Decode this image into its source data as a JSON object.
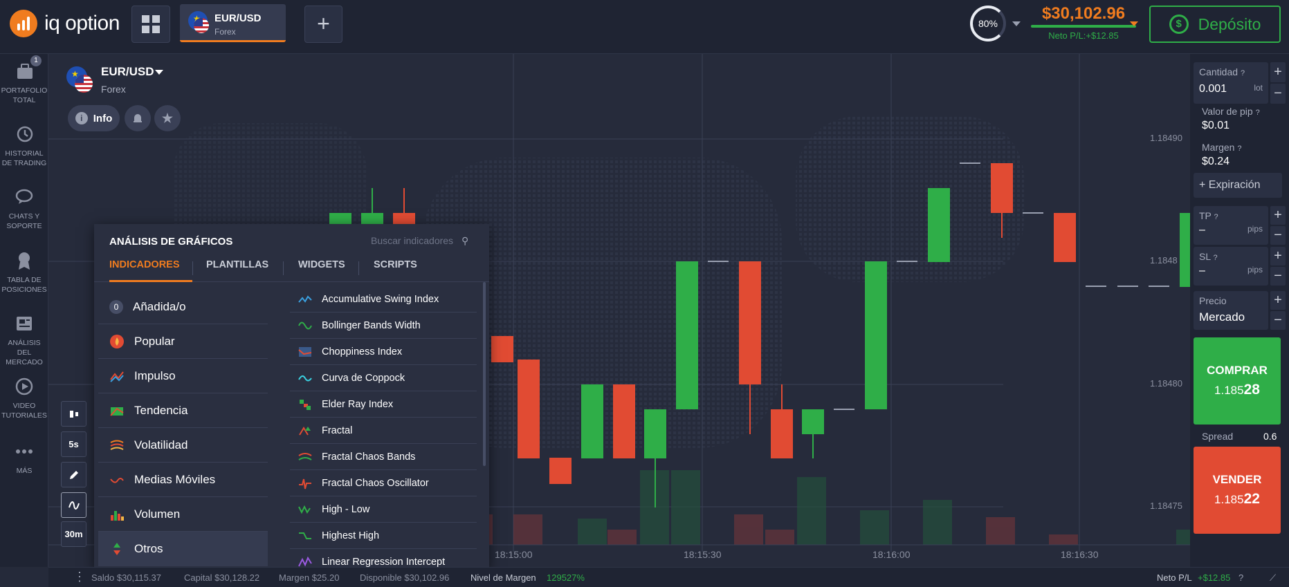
{
  "topbar": {
    "logo_text": "iq option",
    "asset_tab": {
      "pair": "EUR/USD",
      "type": "Forex"
    },
    "plus_label": "+",
    "risk_percent": "80%",
    "balance": "$30,102.96",
    "net_pl": "Neto P/L:+$12.85",
    "deposit_label": "Depósito"
  },
  "leftnav": {
    "items": [
      {
        "label": "PORTAFOLIO TOTAL",
        "icon": "briefcase-icon",
        "badge": "1"
      },
      {
        "label": "HISTORIAL DE TRADING",
        "icon": "history-icon"
      },
      {
        "label": "CHATS Y SOPORTE",
        "icon": "chat-icon"
      },
      {
        "label": "TABLA DE POSICIONES",
        "icon": "medal-icon"
      },
      {
        "label": "ANÁLISIS DEL MERCADO",
        "icon": "news-icon"
      },
      {
        "label": "VIDEO TUTORIALES",
        "icon": "play-icon"
      },
      {
        "label": "MÁS",
        "icon": "more-icon"
      }
    ]
  },
  "chart": {
    "pair": "EUR/USD",
    "market": "Forex",
    "info_label": "Info",
    "price_ticks": [
      "1.18490",
      "1.1848",
      "1.18480",
      "1.18475"
    ],
    "time_ticks": [
      "18:15:00",
      "18:15:30",
      "18:16:00",
      "18:16:30"
    ],
    "timeframe": "5s",
    "period": "30m"
  },
  "panel": {
    "title": "ANÁLISIS DE GRÁFICOS",
    "search_placeholder": "Buscar indicadores",
    "tabs": [
      "INDICADORES",
      "PLANTILLAS",
      "WIDGETS",
      "SCRIPTS"
    ],
    "active_tab": "INDICADORES",
    "added_count": "0",
    "categories": [
      "Añadida/o",
      "Popular",
      "Impulso",
      "Tendencia",
      "Volatilidad",
      "Medias Móviles",
      "Volumen",
      "Otros"
    ],
    "selected_category": "Otros",
    "indicators": [
      "Accumulative Swing Index",
      "Bollinger Bands Width",
      "Choppiness Index",
      "Curva de Coppock",
      "Elder Ray Index",
      "Fractal",
      "Fractal Chaos Bands",
      "Fractal Chaos Oscillator",
      "High - Low",
      "Highest High",
      "Linear Regression Intercept"
    ]
  },
  "right": {
    "cantidad_label": "Cantidad",
    "cantidad_value": "0.001",
    "cantidad_unit": "lot",
    "pip_label": "Valor de pip",
    "pip_value": "$0.01",
    "margin_label": "Margen",
    "margin_value": "$0.24",
    "expiry_label": "+ Expiración",
    "tp_label": "TP",
    "tp_value": "–",
    "sl_label": "SL",
    "sl_value": "–",
    "unit_pips": "pips",
    "price_label": "Precio",
    "price_value": "Mercado",
    "buy_label": "COMPRAR",
    "buy_price_prefix": "1.185",
    "buy_price_suffix": "28",
    "spread_label": "Spread",
    "spread_value": "0.6",
    "sell_label": "VENDER",
    "sell_price_prefix": "1.185",
    "sell_price_suffix": "22"
  },
  "bottom": {
    "saldo": "Saldo $30,115.37",
    "capital": "Capital $30,128.22",
    "margen": "Margen $25.20",
    "disponible": "Disponible $30,102.96",
    "nivel_label": "Nivel de Margen",
    "nivel_value": "129527%",
    "net_label": "Neto P/L",
    "net_value": "+$12.85"
  },
  "colors": {
    "accent": "#f07c1f",
    "up": "#2fae48",
    "down": "#e14b33",
    "background": "#252a3a"
  }
}
